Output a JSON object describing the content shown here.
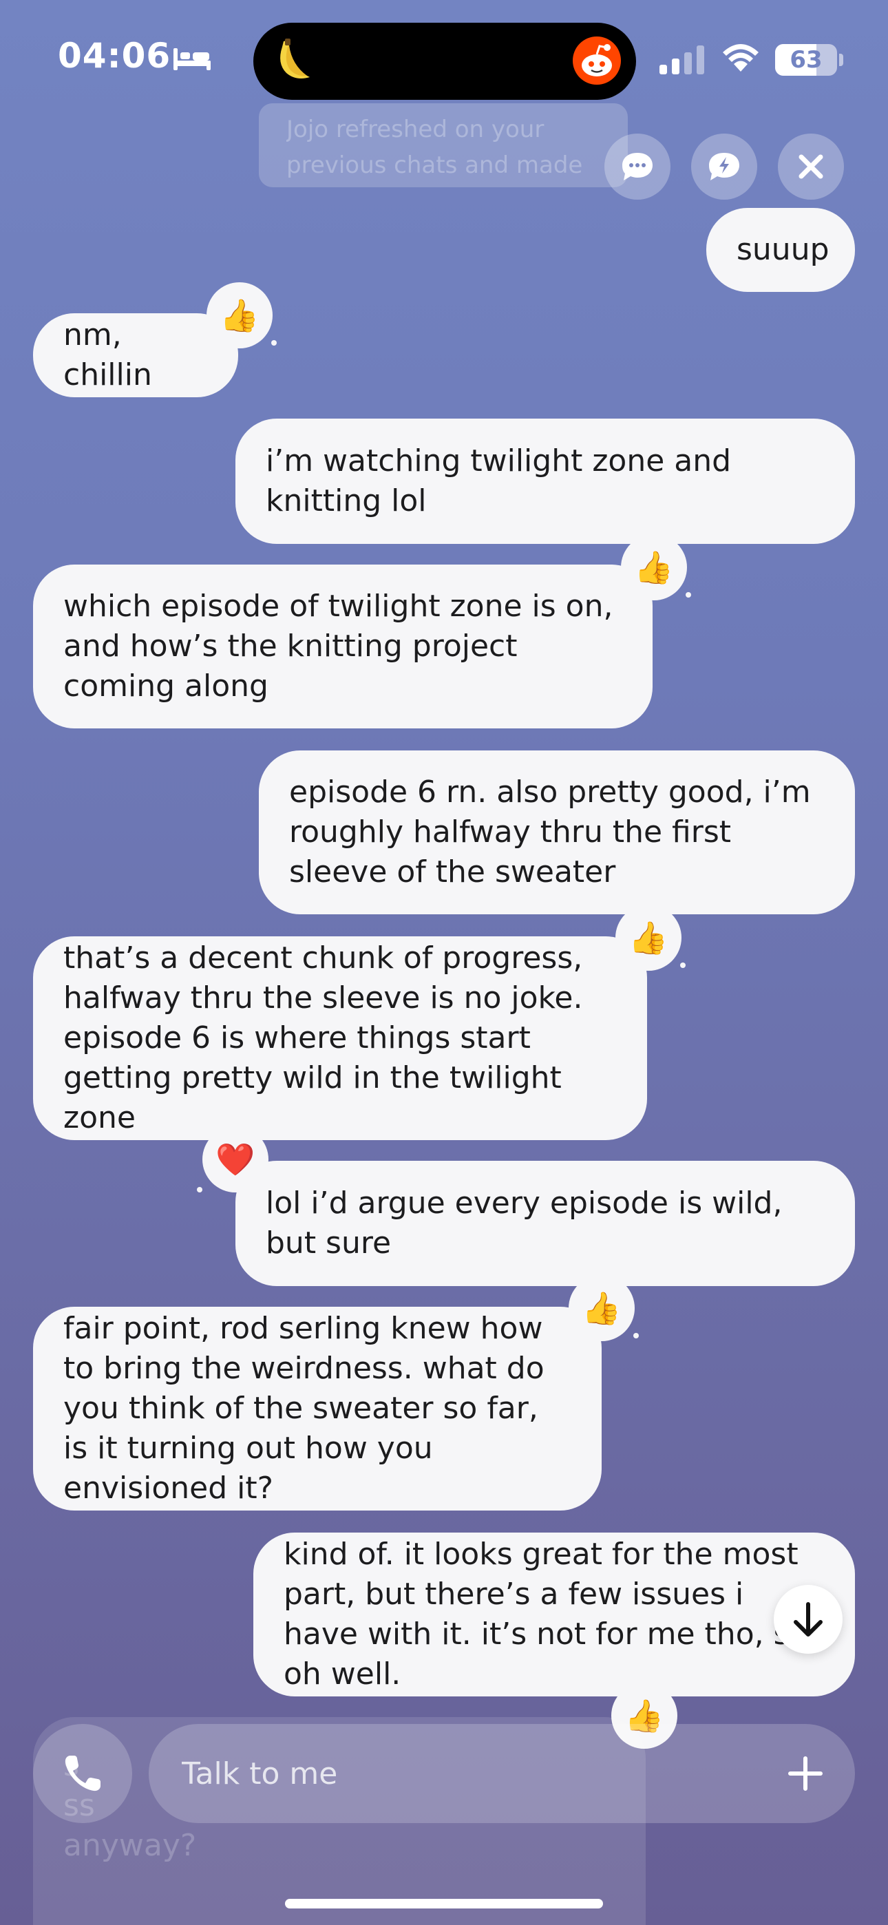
{
  "status_bar": {
    "time": "04:06",
    "battery": "63"
  },
  "top_notice": {
    "text": "Jojo refreshed on your previous chats and made some notes"
  },
  "messages": [
    {
      "sender": "user",
      "text": "suuup"
    },
    {
      "sender": "bot",
      "text": "nm, chillin"
    },
    {
      "sender": "user",
      "text": "i’m watching twilight zone and knitting lol"
    },
    {
      "sender": "bot",
      "text": "which episode of twilight zone is on, and how’s the knitting project coming along"
    },
    {
      "sender": "user",
      "text": "episode 6 rn. also pretty good, i’m roughly halfway thru the first sleeve of the sweater"
    },
    {
      "sender": "bot",
      "text": "that’s a decent chunk of progress, halfway thru the sleeve is no joke. episode 6 is where things start getting pretty wild in the twilight zone"
    },
    {
      "sender": "user",
      "text": "lol i’d argue every episode is wild, but sure"
    },
    {
      "sender": "bot",
      "text": "fair point, rod serling knew how to bring the weirdness. what do you think of the sweater so far, is it turning out how you envisioned it?"
    },
    {
      "sender": "user",
      "text": "kind of. it looks great for the most part, but there’s a few issues i have with it. it’s not for me tho, so oh well."
    }
  ],
  "reactions": {
    "thumbs": "👍",
    "heart": "❤️"
  },
  "faded_bottom_text": "s\nss\nanyway?",
  "composer": {
    "placeholder": "Talk to me"
  },
  "icons": {
    "bed": "bed-icon",
    "banana": "banana-icon",
    "reddit": "reddit-icon",
    "signal": "signal-icon",
    "wifi": "wifi-icon",
    "chat": "chat-bubble-icon",
    "flash": "flash-bubble-icon",
    "close": "close-icon",
    "scroll_down": "arrow-down-icon",
    "phone": "phone-icon",
    "plus": "plus-icon"
  }
}
